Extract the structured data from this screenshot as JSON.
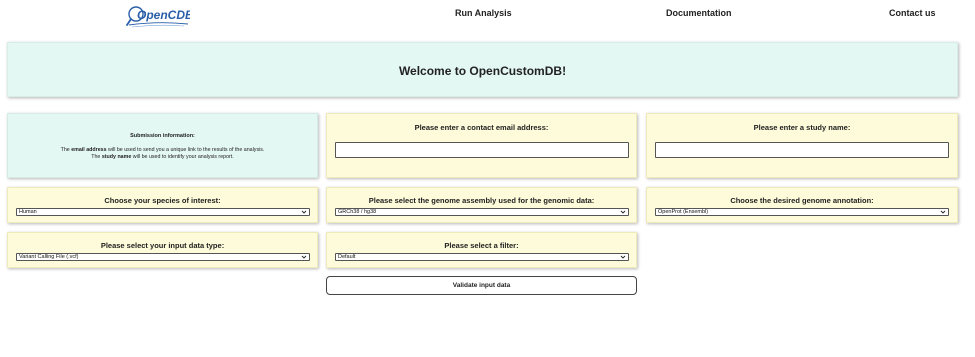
{
  "header": {
    "logo_text": "OpenCDB",
    "nav": [
      {
        "label": "Run Analysis"
      },
      {
        "label": "Documentation"
      },
      {
        "label": "Contact us"
      }
    ]
  },
  "banner": {
    "title": "Welcome to OpenCustomDB!"
  },
  "info": {
    "title": "Submission information:",
    "line1_pre": "The ",
    "line1_bold": "email address",
    "line1_post": " will be used to send you a unique link to the results of the analysis.",
    "line2_pre": "The ",
    "line2_bold": "study name",
    "line2_post": " will be used to identify your analysis report."
  },
  "email": {
    "label": "Please enter a contact email address:",
    "value": "",
    "placeholder": ""
  },
  "study": {
    "label": "Please enter a study name:",
    "value": "",
    "placeholder": ""
  },
  "species": {
    "label": "Choose your species of interest:",
    "selected": "Human"
  },
  "assembly": {
    "label": "Please select the genome assembly used for the genomic data:",
    "selected": "GRCh38 / hg38"
  },
  "annotation": {
    "label": "Choose the desired genome annotation:",
    "selected": "OpenProt (Ensembl)"
  },
  "datatype": {
    "label": "Please select your input data type:",
    "selected": "Variant Calling File (.vcf)"
  },
  "filter": {
    "label": "Please select a filter:",
    "selected": "Default"
  },
  "validate": {
    "label": "Validate input data"
  },
  "colors": {
    "mint_panel": "#e3f7f3",
    "cream_panel": "#fdfbd9",
    "logo_blue": "#2a5fa8"
  }
}
